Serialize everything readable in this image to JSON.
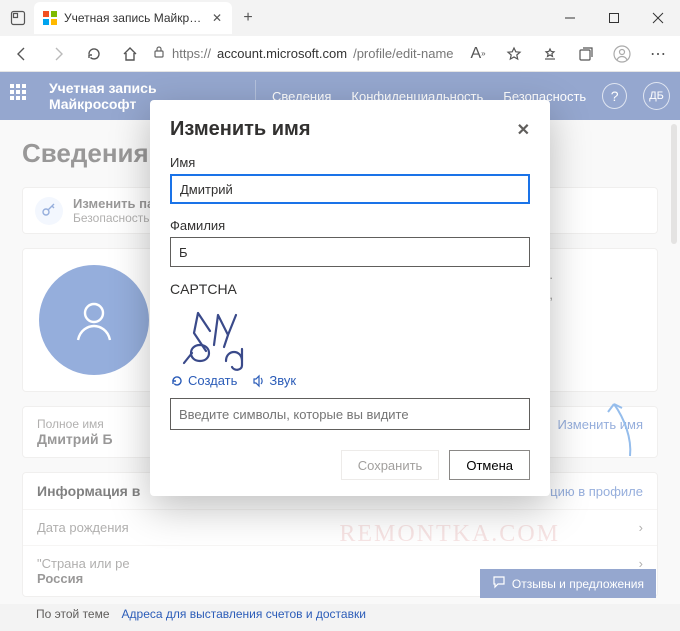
{
  "browser": {
    "tab_title": "Учетная запись Майкрософт | E",
    "url_prefix": "https://",
    "url_host": "account.microsoft.com",
    "url_path": "/profile/edit-name"
  },
  "bluebar": {
    "brand": "Учетная запись Майкрософт",
    "nav": [
      "Сведения",
      "Конфиденциальность",
      "Безопасность"
    ],
    "avatar_initials": "ДБ"
  },
  "page": {
    "heading": "Сведения",
    "banner_title": "Изменить па",
    "banner_sub": "Безопасность",
    "card_text1": "рафии.",
    "card_text2": "устройствах,",
    "fullname_label": "Полное имя",
    "fullname_value": "Дмитрий Б",
    "edit_name": "Изменить имя",
    "account_info": "Информация в",
    "account_edit": "цию в профиле",
    "dob_label": "Дата рождения",
    "country_label": "\"Страна или ре",
    "country_value": "Россия",
    "footer_topic": "По этой теме",
    "footer_link": "Адреса для выставления счетов и доставки",
    "feedback": "Отзывы и предложения"
  },
  "modal": {
    "title": "Изменить имя",
    "first_label": "Имя",
    "first_value": "Дмитрий",
    "last_label": "Фамилия",
    "last_value": "Б",
    "captcha_label": "CAPTCHA",
    "captcha_new": "Создать",
    "captcha_audio": "Звук",
    "captcha_placeholder": "Введите символы, которые вы видите",
    "save": "Сохранить",
    "cancel": "Отмена"
  },
  "watermark": "REMONTKA.COM"
}
